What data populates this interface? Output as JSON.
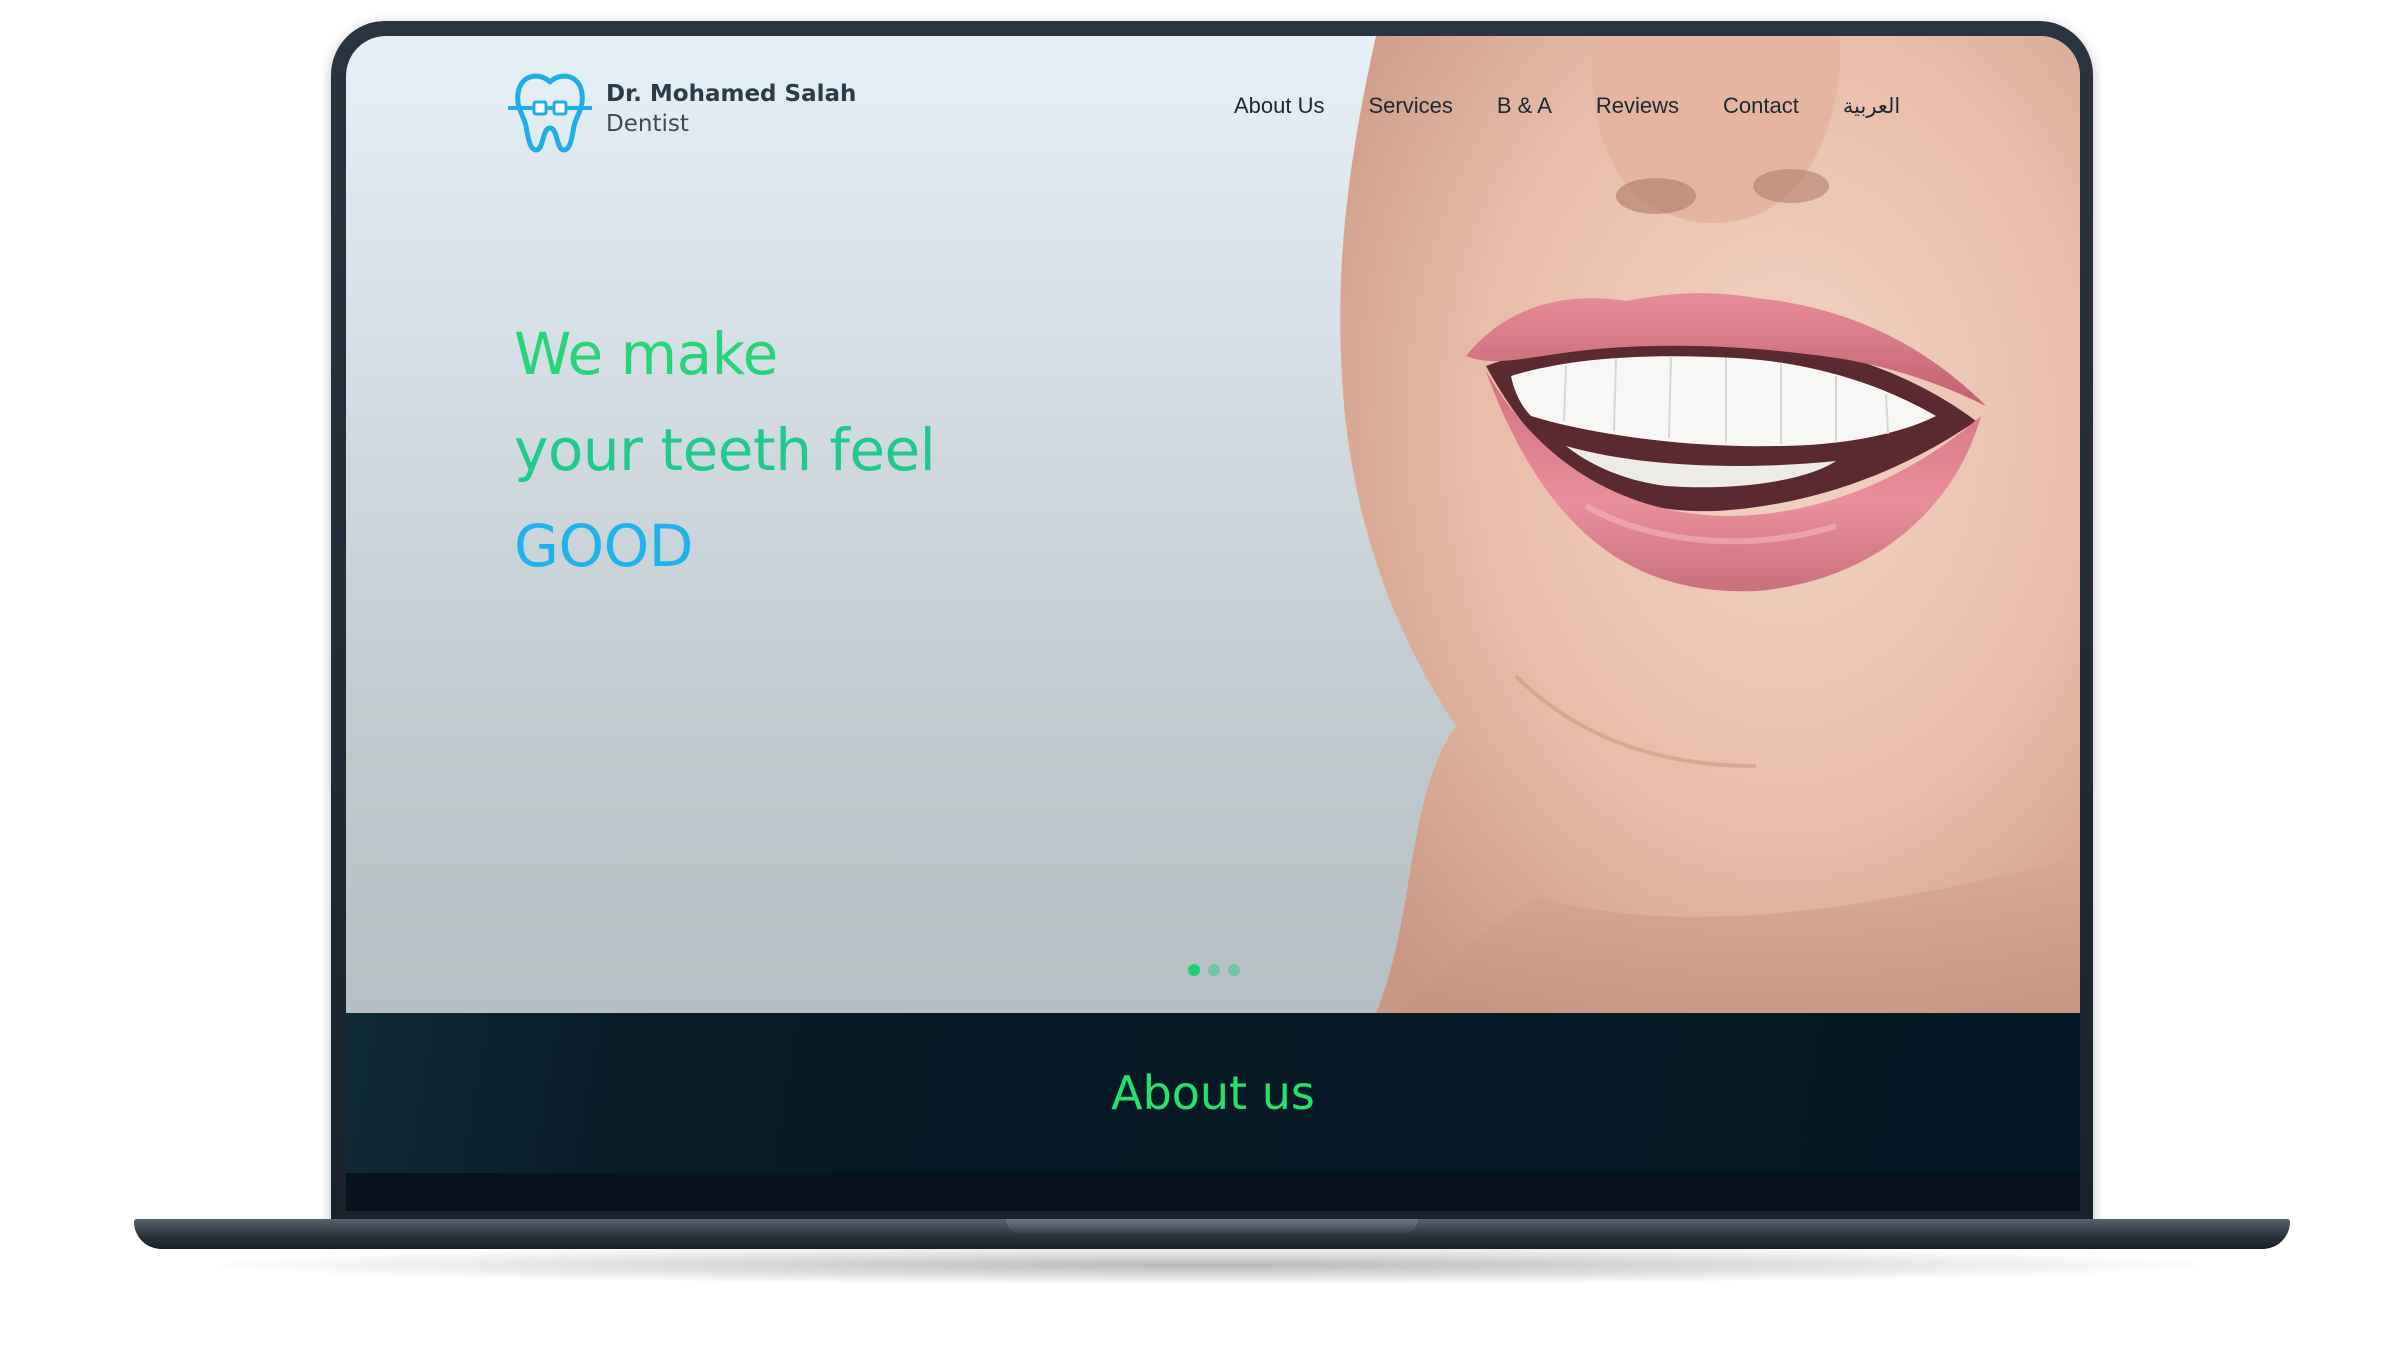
{
  "brand": {
    "name": "Dr. Mohamed Salah",
    "subtitle": "Dentist",
    "logo_icon": "tooth-braces-icon"
  },
  "nav": {
    "items": [
      "About Us",
      "Services",
      "B & A",
      "Reviews",
      "Contact"
    ],
    "language_link": "العربية"
  },
  "hero": {
    "headline": [
      "We make",
      "your teeth feel",
      "GOOD"
    ],
    "slides_total": 3,
    "active_slide": 1
  },
  "about": {
    "title": "About us"
  },
  "colors": {
    "accent_green": "#27d47a",
    "accent_blue": "#1fb3ea",
    "dark_section": "#041724",
    "logo_blue": "#20aee8"
  }
}
